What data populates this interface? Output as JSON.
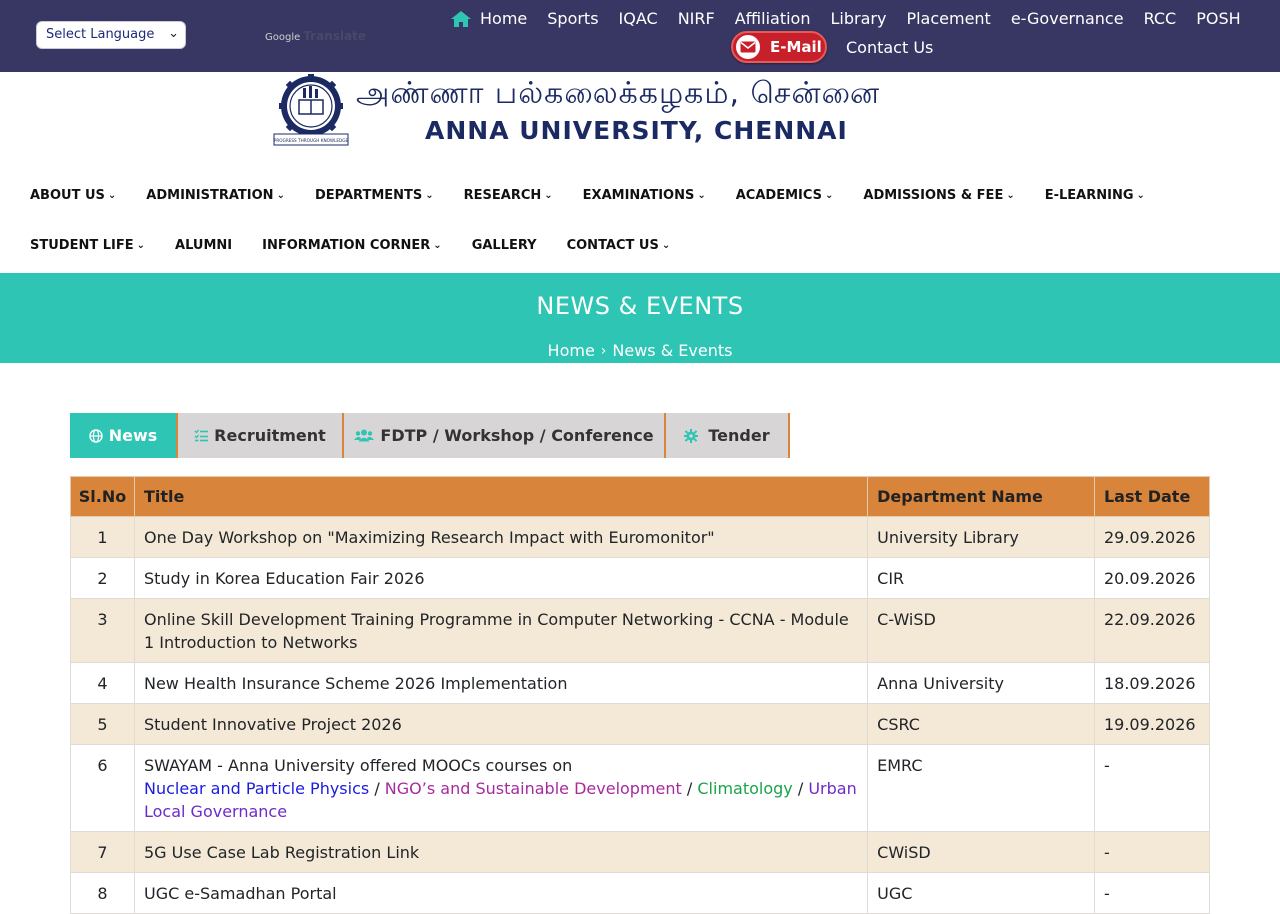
{
  "topbar": {
    "language_select": "Select Language",
    "google_label": "Google",
    "translate_label": "Translate",
    "links": [
      "Home",
      "Sports",
      "IQAC",
      "NIRF",
      "Affiliation",
      "Library",
      "Placement",
      "e-Governance",
      "RCC",
      "POSH"
    ],
    "email_label": "E-Mail",
    "contact_label": "Contact Us"
  },
  "logo": {
    "tamil": "அண்ணா பல்கலைக்கழகம், சென்னை",
    "english": "ANNA UNIVERSITY, CHENNAI",
    "emblem_text": "PROGRESS THROUGH KNOWLEDGE"
  },
  "nav": {
    "row1": [
      "ABOUT US",
      "ADMINISTRATION",
      "DEPARTMENTS",
      "RESEARCH",
      "EXAMINATIONS",
      "ACADEMICS",
      "ADMISSIONS & FEE",
      "E-LEARNING"
    ],
    "row2": [
      "STUDENT LIFE",
      "ALUMNI",
      "INFORMATION CORNER",
      "GALLERY",
      "CONTACT US"
    ]
  },
  "banner": {
    "title": "NEWS & EVENTS",
    "crumb_home": "Home",
    "crumb_current": "News & Events"
  },
  "tabs": [
    "News",
    "Recruitment",
    "FDTP / Workshop / Conference",
    "Tender"
  ],
  "table": {
    "headers": [
      "Sl.No",
      "Title",
      "Department Name",
      "Last Date"
    ],
    "rows": [
      {
        "sl": "1",
        "title": "One Day Workshop on \"Maximizing Research Impact with Euromonitor\"",
        "dept": "University Library",
        "date": "29.09.2026"
      },
      {
        "sl": "2",
        "title": "Study in Korea Education Fair 2026",
        "dept": "CIR",
        "date": "20.09.2026"
      },
      {
        "sl": "3",
        "title": "Online Skill Development Training Programme in Computer Networking - CCNA - Module 1 Introduction to Networks",
        "dept": "C-WiSD",
        "date": "22.09.2026"
      },
      {
        "sl": "4",
        "title": "New Health Insurance Scheme 2026 Implementation",
        "dept": "Anna University",
        "date": "18.09.2026"
      },
      {
        "sl": "5",
        "title": "Student Innovative Project 2026",
        "dept": "CSRC",
        "date": "19.09.2026"
      },
      {
        "sl": "6",
        "title": "SWAYAM - Anna University offered MOOCs courses on",
        "dept": "EMRC",
        "date": "-",
        "links": [
          "Nuclear and Particle Physics",
          "NGO’s and Sustainable Development",
          "Climatology",
          "Urban Local Governance"
        ]
      },
      {
        "sl": "7",
        "title": "5G Use Case Lab Registration Link",
        "dept": "CWiSD",
        "date": "-"
      },
      {
        "sl": "8",
        "title": "UGC e-Samadhan Portal",
        "dept": "UGC",
        "date": "-"
      }
    ]
  }
}
